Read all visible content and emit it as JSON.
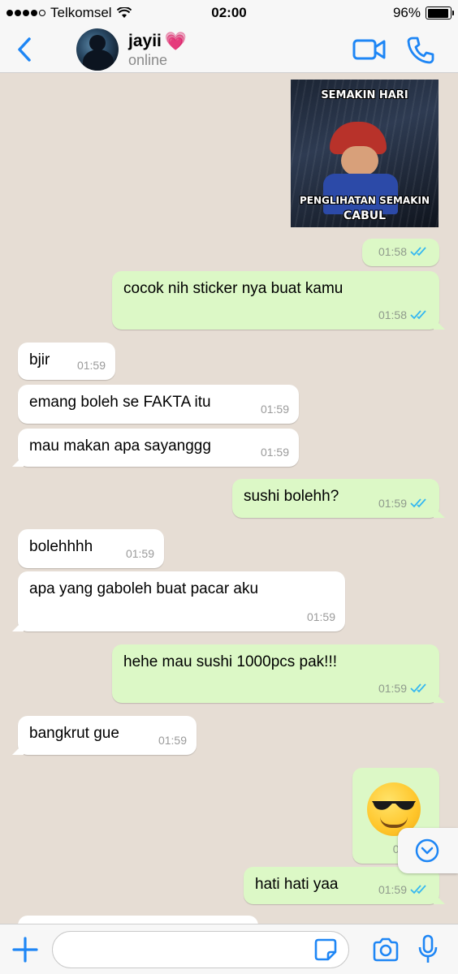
{
  "status_bar": {
    "carrier": "Telkomsel",
    "time": "02:00",
    "battery": "96%",
    "battery_level": 0.96
  },
  "header": {
    "contact_name": "jayii",
    "contact_emoji": "💗",
    "contact_status": "online",
    "icons": [
      "back-icon",
      "avatar",
      "video-call-icon",
      "phone-icon"
    ]
  },
  "sticker": {
    "top_text": "SEMAKIN HARI",
    "bottom_text": "PENGLIHATAN SEMAKIN",
    "bottom_text_2": "CABUL"
  },
  "messages": [
    {
      "dir": "out",
      "text": "",
      "time": "01:58",
      "read": true,
      "kind": "sticker-time"
    },
    {
      "dir": "out",
      "text": "cocok nih sticker nya buat kamu",
      "time": "01:58",
      "read": true
    },
    {
      "dir": "in",
      "text": "bjir",
      "time": "01:59"
    },
    {
      "dir": "in",
      "text": "emang boleh se FAKTA itu",
      "time": "01:59"
    },
    {
      "dir": "in",
      "text": "mau makan apa sayanggg",
      "time": "01:59"
    },
    {
      "dir": "out",
      "text": "sushi bolehh?",
      "time": "01:59",
      "read": true
    },
    {
      "dir": "in",
      "text": "bolehhhh",
      "time": "01:59"
    },
    {
      "dir": "in",
      "text": "apa yang gaboleh buat pacar aku",
      "time": "01:59"
    },
    {
      "dir": "out",
      "text": "hehe mau sushi 1000pcs pak!!!",
      "time": "01:59",
      "read": true
    },
    {
      "dir": "in",
      "text": "bangkrut gue",
      "time": "01:59"
    },
    {
      "dir": "out",
      "text": "😎",
      "time": "01:5",
      "read": true,
      "kind": "emoji"
    },
    {
      "dir": "out",
      "text": "hati hati yaa",
      "time": "01:59",
      "read": true
    }
  ],
  "input": {
    "placeholder": "",
    "value": ""
  },
  "colors": {
    "accent": "#1e86f5",
    "outgoing": "#dcf8c6",
    "incoming": "#ffffff",
    "background": "#e6ddd4",
    "read_ticks": "#34b7f1"
  }
}
